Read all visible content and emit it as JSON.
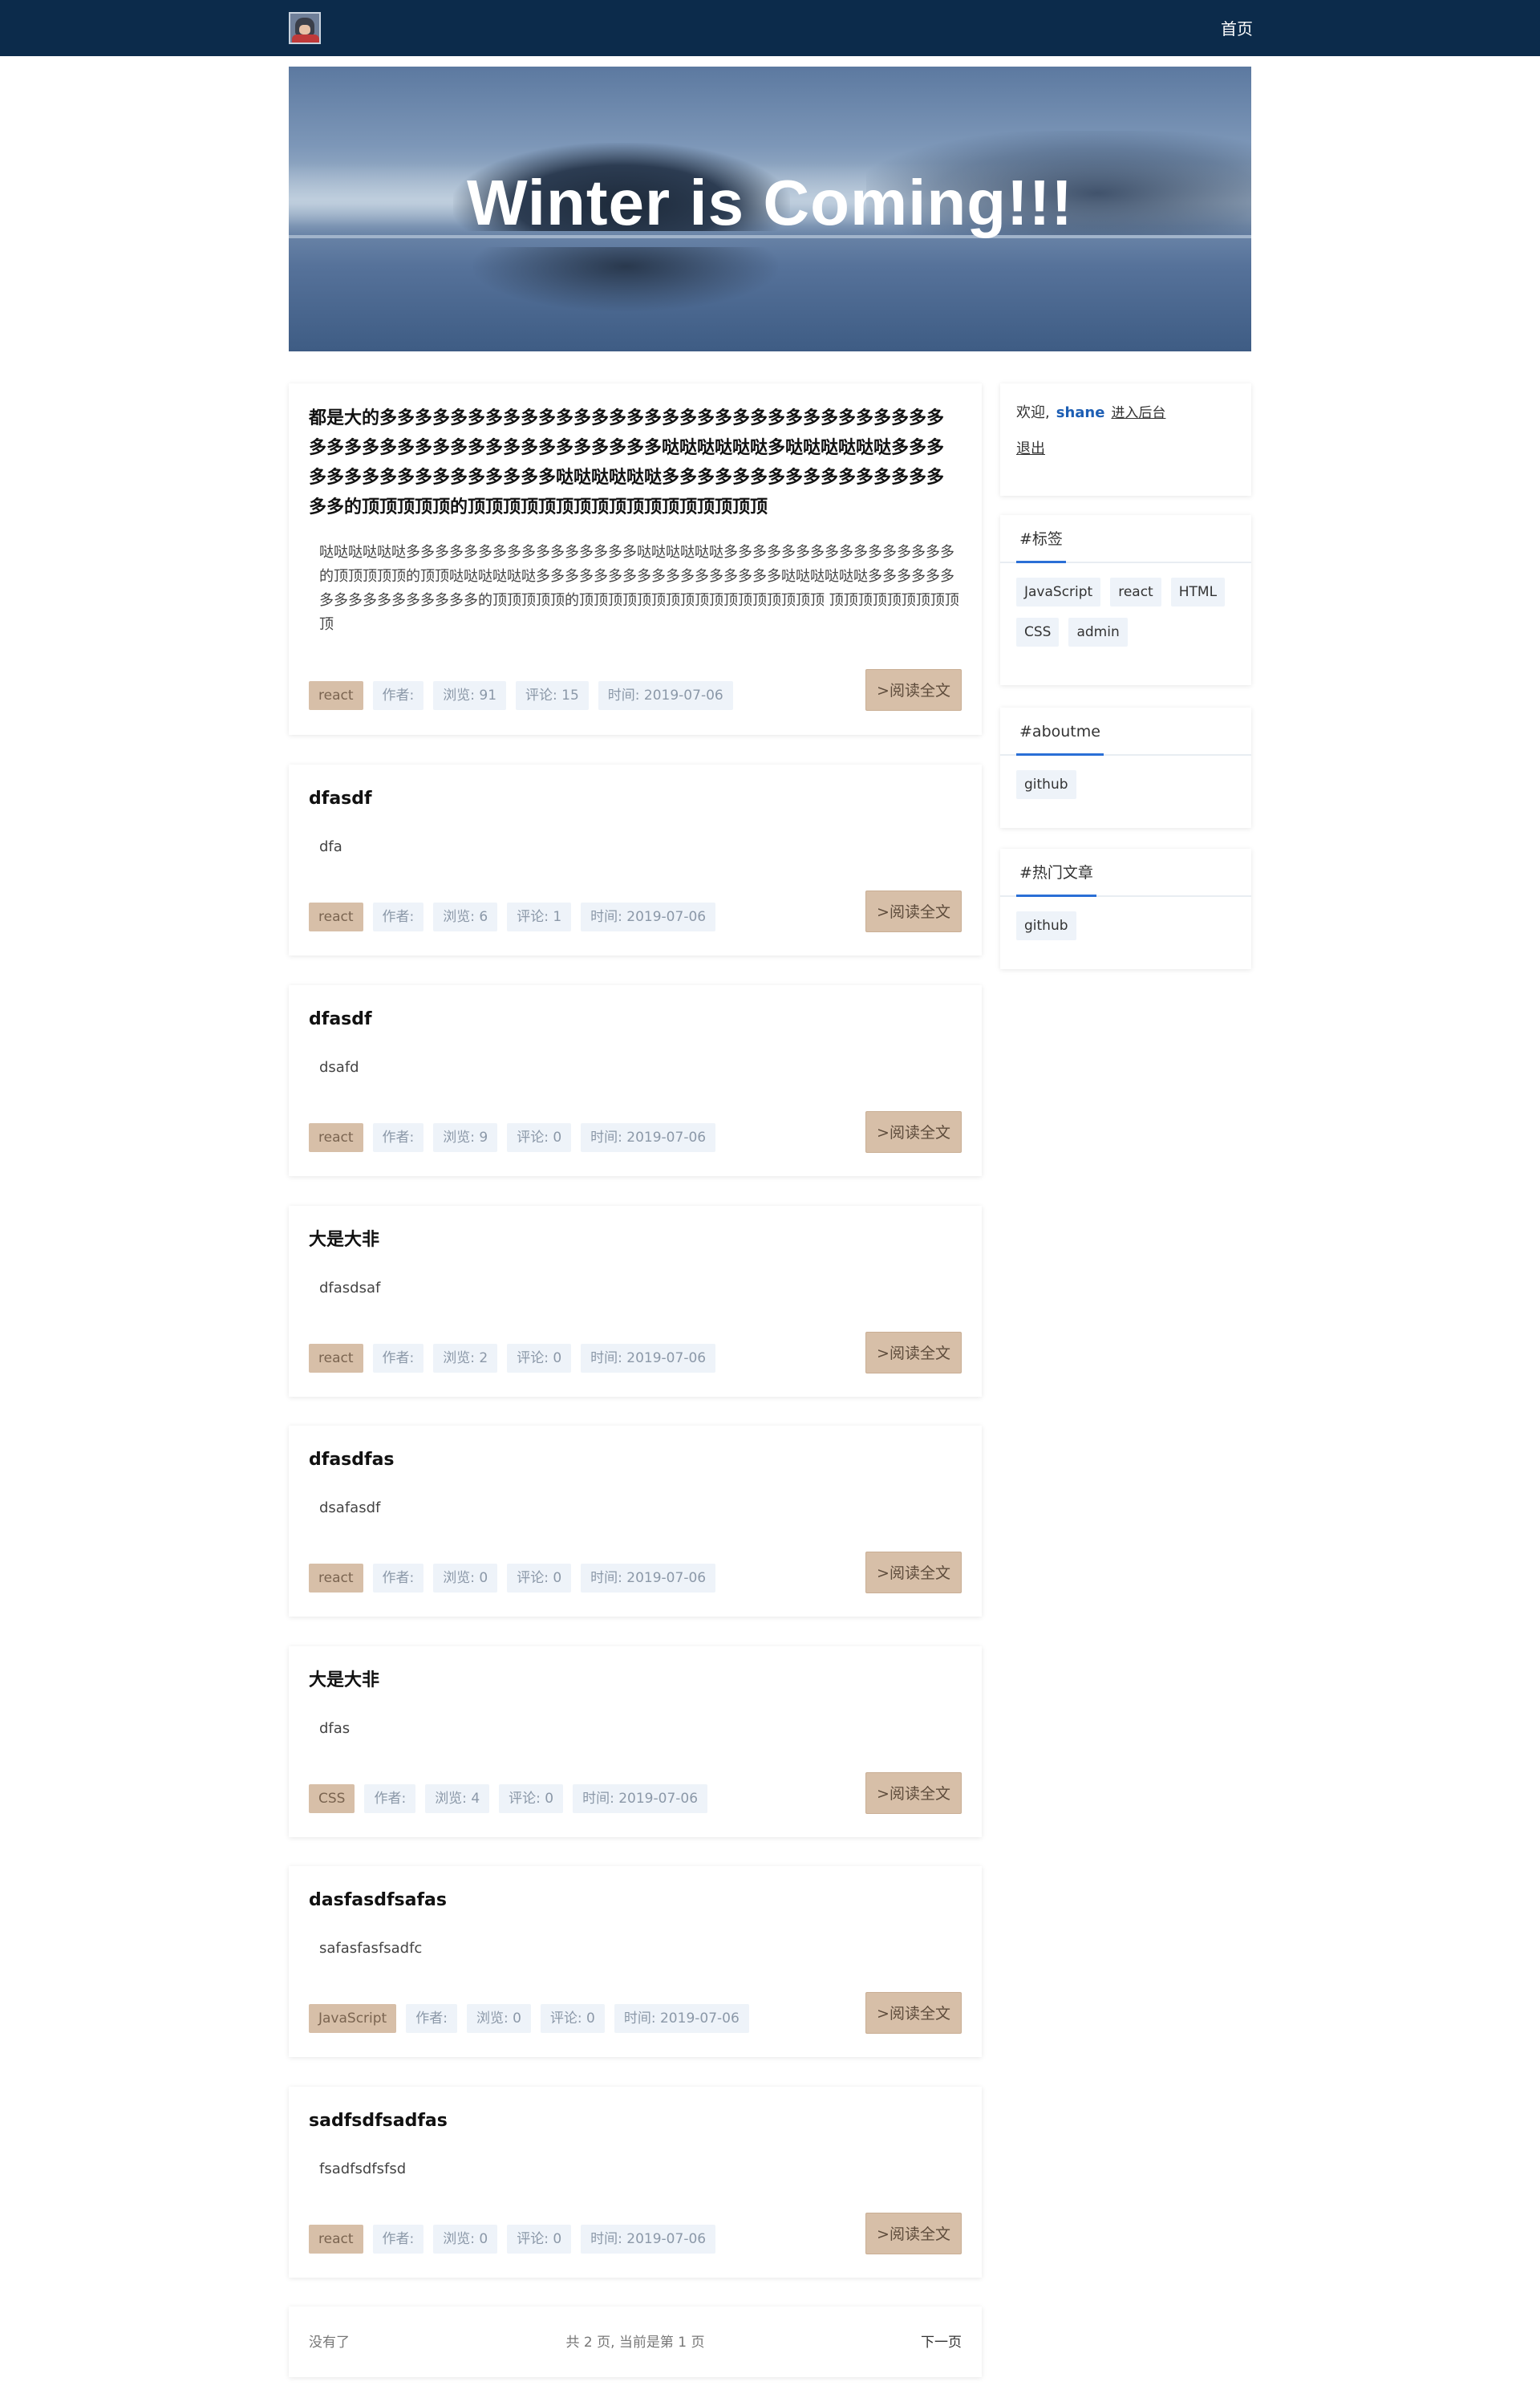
{
  "header": {
    "nav_home": "首页"
  },
  "banner": {
    "title": "Winter is Coming!!!"
  },
  "posts": [
    {
      "title": "都是大的多多多多多多多多多多多多多多多多多多多多多多多多多多多多多多多多多多多多多多多多多多多多多多多多多多多多哒哒哒哒哒哒多哒哒哒哒哒哒多多多多多多多多多多多多多多多多多哒哒哒哒哒哒多多多多多多多多多多多多多多多多多多的顶顶顶顶顶的顶顶顶顶顶顶顶顶顶顶顶顶顶顶顶顶顶",
      "excerpt": "哒哒哒哒哒哒多多多多多多多多多多多多多多多多哒哒哒哒哒哒多多多多多多多多多多多多多多多多的顶顶顶顶顶的顶顶哒哒哒哒哒哒多多多多多多多多多多多多多多多多多哒哒哒哒哒哒多多多多多多多多多多多多多多多多多的顶顶顶顶顶的顶顶顶顶顶顶顶顶顶顶顶顶顶顶顶顶顶 顶顶顶顶顶顶顶顶顶顶",
      "tag": "react",
      "author": "作者:",
      "views": "浏览: 91",
      "comments": "评论: 15",
      "date": "时间: 2019-07-06",
      "read_more": ">阅读全文"
    },
    {
      "title": "dfasdf",
      "excerpt": "dfa",
      "tag": "react",
      "author": "作者:",
      "views": "浏览: 6",
      "comments": "评论: 1",
      "date": "时间: 2019-07-06",
      "read_more": ">阅读全文"
    },
    {
      "title": "dfasdf",
      "excerpt": "dsafd",
      "tag": "react",
      "author": "作者:",
      "views": "浏览: 9",
      "comments": "评论: 0",
      "date": "时间: 2019-07-06",
      "read_more": ">阅读全文"
    },
    {
      "title": "大是大非",
      "excerpt": "dfasdsaf",
      "tag": "react",
      "author": "作者:",
      "views": "浏览: 2",
      "comments": "评论: 0",
      "date": "时间: 2019-07-06",
      "read_more": ">阅读全文"
    },
    {
      "title": "dfasdfas",
      "excerpt": "dsafasdf",
      "tag": "react",
      "author": "作者:",
      "views": "浏览: 0",
      "comments": "评论: 0",
      "date": "时间: 2019-07-06",
      "read_more": ">阅读全文"
    },
    {
      "title": "大是大非",
      "excerpt": "dfas",
      "tag": "CSS",
      "author": "作者:",
      "views": "浏览: 4",
      "comments": "评论: 0",
      "date": "时间: 2019-07-06",
      "read_more": ">阅读全文"
    },
    {
      "title": "dasfasdfsafas",
      "excerpt": "safasfasfsadfc",
      "tag": "JavaScript",
      "author": "作者:",
      "views": "浏览: 0",
      "comments": "评论: 0",
      "date": "时间: 2019-07-06",
      "read_more": ">阅读全文"
    },
    {
      "title": "sadfsdfsadfas",
      "excerpt": "fsadfsdfsfsd",
      "tag": "react",
      "author": "作者:",
      "views": "浏览: 0",
      "comments": "评论: 0",
      "date": "时间: 2019-07-06",
      "read_more": ">阅读全文"
    }
  ],
  "pagination": {
    "prev": "没有了",
    "info": "共 2 页, 当前是第 1 页",
    "next": "下一页"
  },
  "sidebar": {
    "welcome": {
      "greeting": "欢迎,",
      "username": "shane",
      "admin_link": "进入后台",
      "logout": "退出"
    },
    "tags_section": {
      "title": "#标签",
      "items": [
        "JavaScript",
        "react",
        "HTML",
        "CSS",
        "admin"
      ]
    },
    "about_section": {
      "title": "#aboutme",
      "items": [
        "github"
      ]
    },
    "hot_section": {
      "title": "#热门文章",
      "items": [
        "github"
      ]
    }
  },
  "colors": {
    "header_bg": "#0c2b4b",
    "tag_chip_bg": "#d7bfa8",
    "meta_chip_bg": "#eef3f9",
    "username_color": "#1e5fb4",
    "tab_underline": "#2a6fd6"
  }
}
